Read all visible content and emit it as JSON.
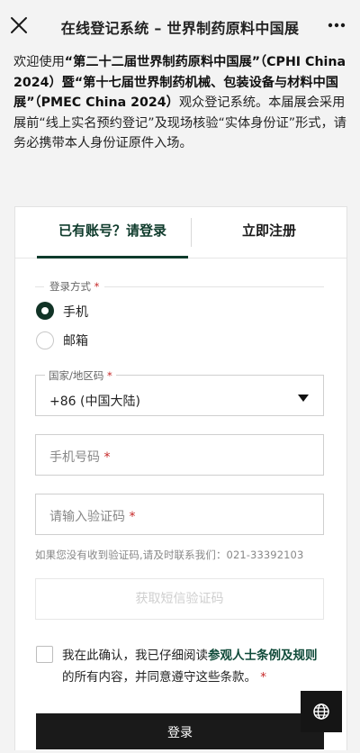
{
  "header": {
    "title": "在线登记系统 – 世界制药原料中国展",
    "close_icon": "close-icon",
    "more_icon": "more-dots-icon"
  },
  "intro": {
    "t1": "欢迎使用",
    "b1": "“第二十二届世界制药原料中国展”（CPHI China 2024）暨“第十七届世界制药机械、包装设备与材料中国展”（PMEC China 2024）",
    "t2": "观众登记系统。本届展会采用展前“线上实名预约登记”及现场核验“实体身份证”形式，请务必携带本人身份证原件入场。"
  },
  "tabs": {
    "login": "已有账号？请登录",
    "register": "立即注册"
  },
  "login_method": {
    "label": "登录方式",
    "required": "*",
    "options": [
      "手机",
      "邮箱"
    ],
    "selected": "手机"
  },
  "country": {
    "label": "国家/地区码",
    "required": "*",
    "value": "+86 (中国大陆)"
  },
  "phone": {
    "placeholder": "手机号码",
    "required": "*"
  },
  "code": {
    "placeholder": "请输入验证码",
    "required": "*"
  },
  "helper_text": "如果您没有收到验证码,请及时联系我们：021-33392103",
  "sms_button": "获取短信验证码",
  "consent": {
    "t1": "我在此确认，我已仔细阅读",
    "link": "参观人士条例及规则",
    "t2": "的所有内容，并同意遵守这些条款。",
    "required": "*"
  },
  "login_button": "登录",
  "colors": {
    "brand": "#0f3b2c",
    "required": "#c62828",
    "button": "#1a1a1a"
  }
}
